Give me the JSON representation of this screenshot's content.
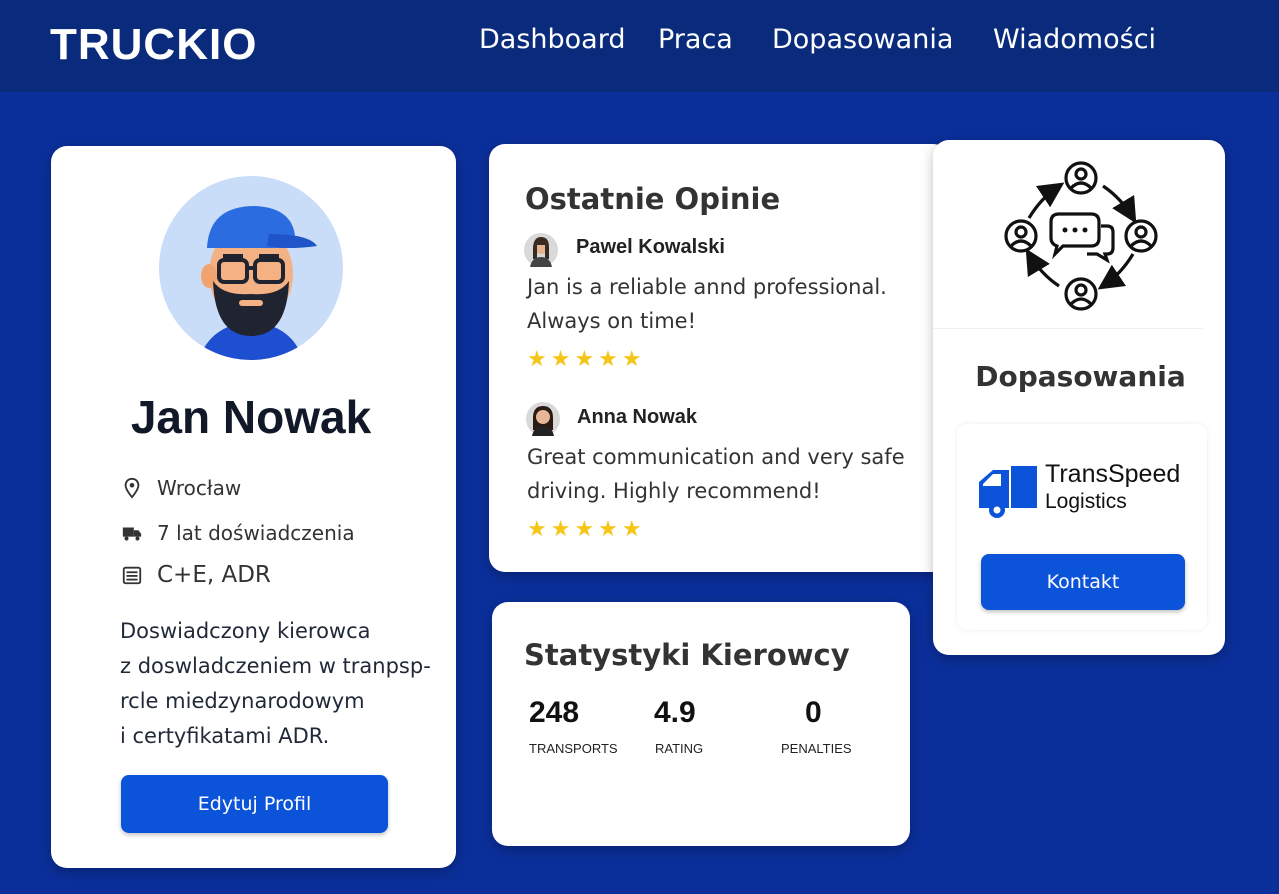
{
  "app": {
    "logo": "TRUCKIO"
  },
  "nav": {
    "items": [
      {
        "label": "Dashboard"
      },
      {
        "label": "Praca"
      },
      {
        "label": "Dopasowania"
      },
      {
        "label": "Wiadomości"
      }
    ]
  },
  "profile": {
    "name": "Jan Nowak",
    "location": "Wrocław",
    "experience": "7 lat doświadczenia",
    "licenses": "C+E, ADR",
    "bio_lines": [
      "Doswiadczony kierowca",
      "z doswladczeniem w tranpsp-",
      "rcle miedzynarodowym",
      "i certyfikatami ADR."
    ],
    "edit_button": "Edytuj Profil",
    "icons": {
      "location": "map-pin-icon",
      "experience": "truck-icon",
      "licenses": "license-card-icon"
    }
  },
  "reviews": {
    "title": "Ostatnie Opinie",
    "items": [
      {
        "author": "Pawel Kowalski",
        "text_lines": [
          "Jan is a reliable annd professional.",
          "Always on time!"
        ],
        "rating": 5,
        "stars": "★★★★★"
      },
      {
        "author": "Anna Nowak",
        "text_lines": [
          "Great communication and very safe",
          "driving. Highly recommend!"
        ],
        "rating": 5,
        "stars": "★★★★★"
      }
    ]
  },
  "stats": {
    "title": "Statystyki Kierowcy",
    "items": [
      {
        "value": "248",
        "label": "TRANSPORTS"
      },
      {
        "value": "4.9",
        "label": "RATING"
      },
      {
        "value": "0",
        "label": "PENALTIES"
      }
    ]
  },
  "matches": {
    "title": "Dopasowania",
    "icon": "network-chat-icon",
    "company": {
      "name_line1": "TransSpeed",
      "name_line2": "Logistics",
      "logo_icon": "truck-logo-icon"
    },
    "contact_button": "Kontakt"
  },
  "colors": {
    "background": "#0b2f9a",
    "topbar": "#0a2a7c",
    "button": "#0b53d9",
    "star": "#f5c518",
    "logo_truck": "#0b53d9"
  }
}
